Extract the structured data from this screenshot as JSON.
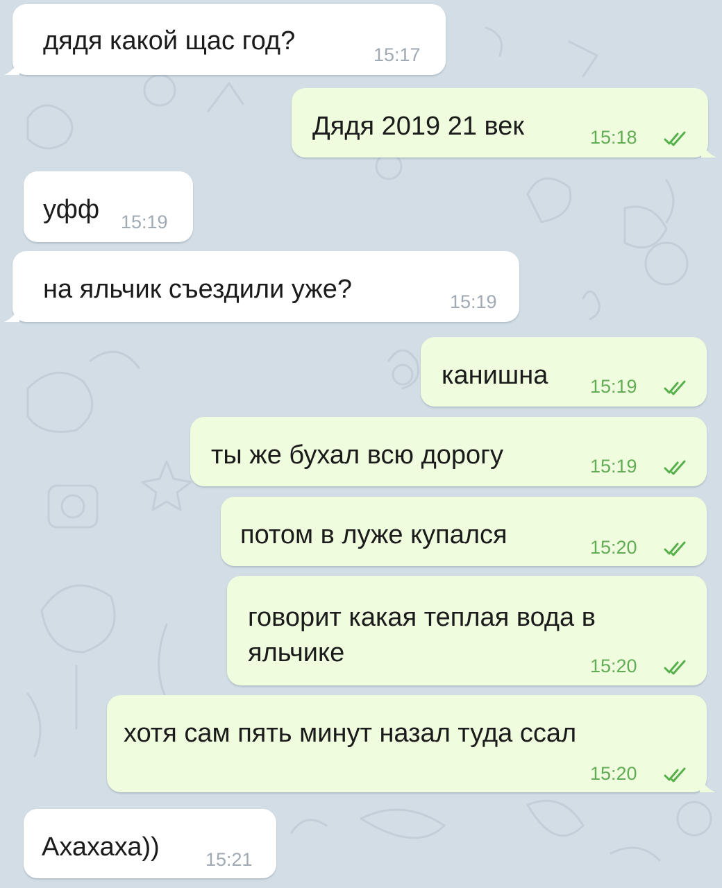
{
  "colors": {
    "background": "#d3dde5",
    "incoming_bubble": "#ffffff",
    "outgoing_bubble": "#effdde",
    "incoming_time": "#a1aab3",
    "outgoing_time": "#62ac55",
    "read_checks": "#55b04a"
  },
  "messages": [
    {
      "text": "дядя какой щас год?",
      "time": "15:17",
      "direction": "incoming"
    },
    {
      "text": "Дядя 2019 21 век",
      "time": "15:18",
      "direction": "outgoing",
      "status": "read"
    },
    {
      "text": "уфф",
      "time": "15:19",
      "direction": "incoming"
    },
    {
      "text": "на яльчик съездили уже?",
      "time": "15:19",
      "direction": "incoming"
    },
    {
      "text": "канишна",
      "time": "15:19",
      "direction": "outgoing",
      "status": "read"
    },
    {
      "text": "ты же бухал всю дорогу",
      "time": "15:19",
      "direction": "outgoing",
      "status": "read"
    },
    {
      "text": "потом в луже купался",
      "time": "15:20",
      "direction": "outgoing",
      "status": "read"
    },
    {
      "text_lines": [
        "говорит какая теплая вода в",
        "яльчике"
      ],
      "time": "15:20",
      "direction": "outgoing",
      "status": "read"
    },
    {
      "text": "хотя сам пять минут назал туда ссал",
      "time": "15:20",
      "direction": "outgoing",
      "status": "read"
    },
    {
      "text": "Ахахаха))",
      "time": "15:21",
      "direction": "incoming"
    }
  ]
}
